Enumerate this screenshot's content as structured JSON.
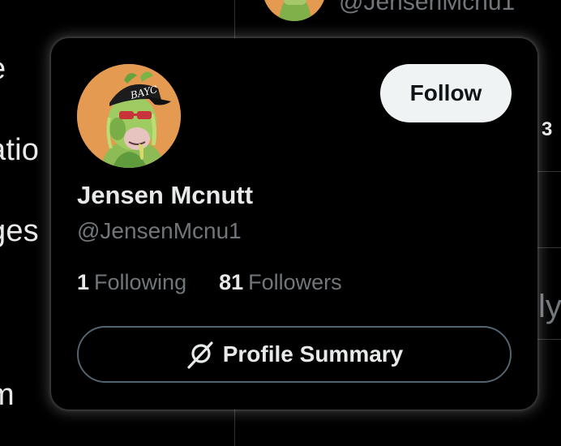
{
  "background": {
    "nav_fragments": [
      "e",
      "atio",
      "ges",
      "m"
    ],
    "top_handle": "@JensenMcnu1",
    "right_number": "3",
    "right_text": "ly"
  },
  "card": {
    "display_name": "Jensen Mcnutt",
    "handle": "@JensenMcnu1",
    "follow_label": "Follow",
    "stats": {
      "following_count": "1",
      "following_label": "Following",
      "followers_count": "81",
      "followers_label": "Followers"
    },
    "summary_label": "Profile Summary",
    "avatar_cap_text": "BAYC"
  },
  "colors": {
    "background": "#000000",
    "text_primary": "#e7e9ea",
    "text_secondary": "#71767b",
    "follow_bg": "#eff3f4",
    "follow_text": "#0f1419",
    "outline": "#536471",
    "avatar_bg": "#e59a52"
  },
  "icons": {
    "summary": "slashed-circle-icon"
  }
}
